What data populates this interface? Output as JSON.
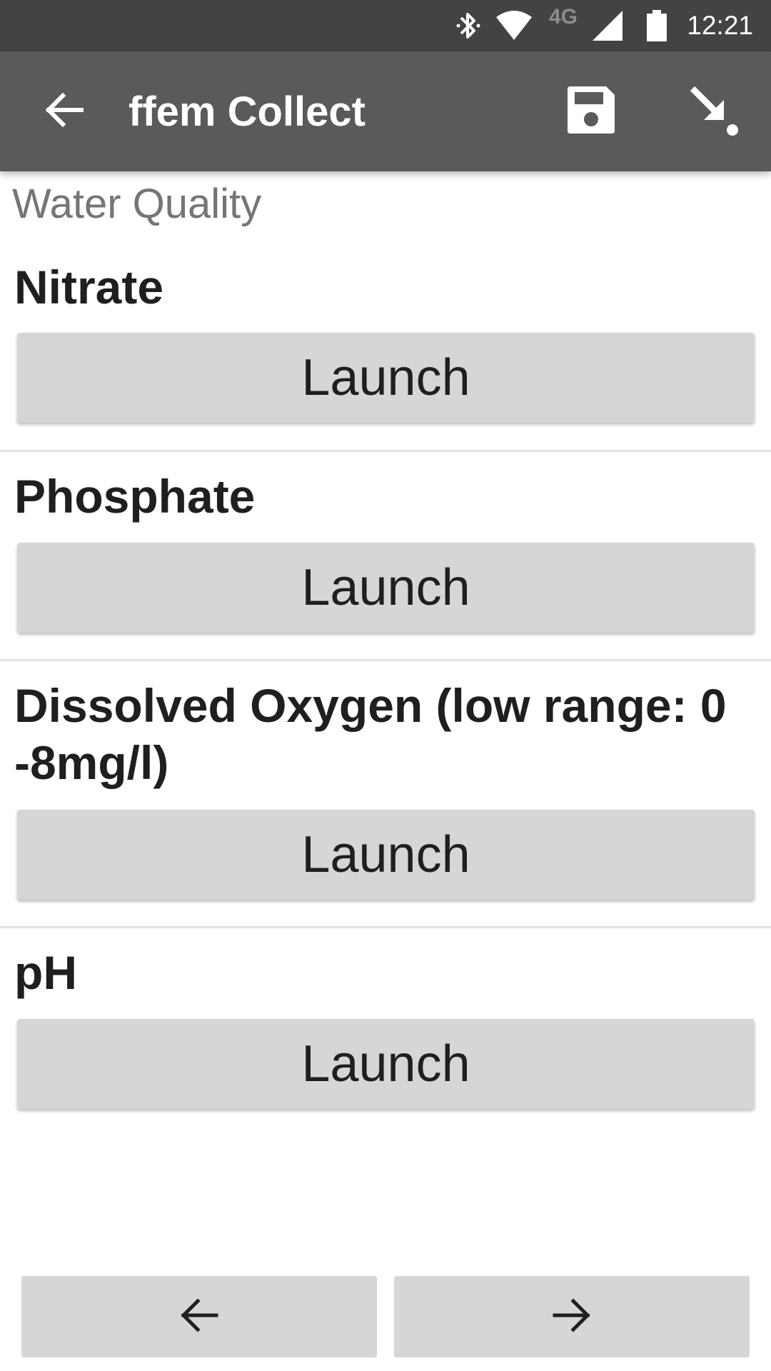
{
  "status_bar": {
    "network_label": "4G",
    "time": "12:21",
    "icons": [
      "bluetooth-icon",
      "wifi-icon",
      "cell-signal-icon",
      "battery-icon"
    ]
  },
  "app_bar": {
    "title": "ffem Collect",
    "icons": [
      "back-arrow-icon",
      "save-icon",
      "finalize-icon"
    ]
  },
  "group": {
    "label": "Water Quality"
  },
  "questions": [
    {
      "label": "Nitrate",
      "button_label": "Launch"
    },
    {
      "label": "Phosphate",
      "button_label": "Launch"
    },
    {
      "label": "Dissolved Oxygen (low range: 0 -8mg/l)",
      "button_label": "Launch"
    },
    {
      "label": "pH",
      "button_label": "Launch"
    }
  ],
  "navigation": {
    "icons": [
      "arrow-left-icon",
      "arrow-right-icon"
    ]
  },
  "colors": {
    "status_bar": "#434343",
    "app_bar": "#5a5a5a",
    "button": "#d6d6d6",
    "group_label": "#757575"
  }
}
